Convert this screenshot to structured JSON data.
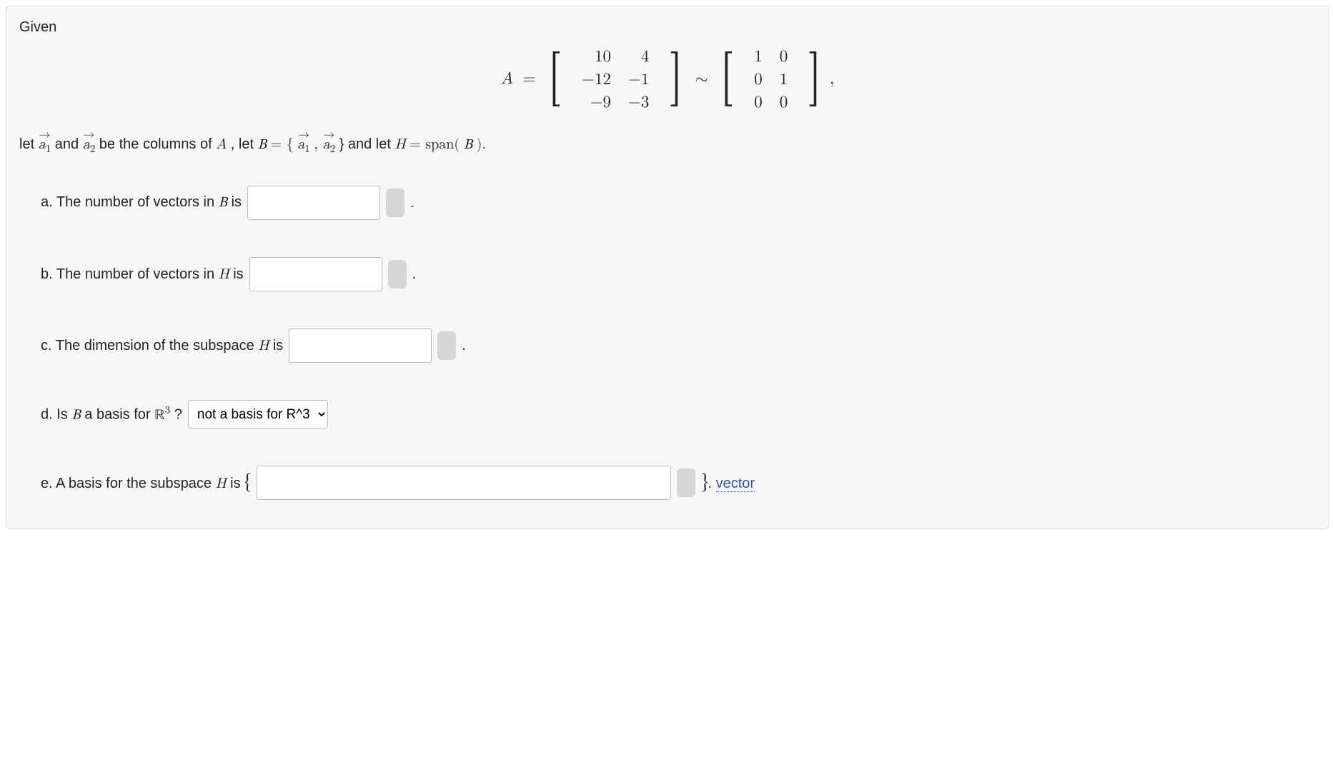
{
  "intro": "Given",
  "matrix_eq": {
    "lhs_var": "A",
    "eq": "=",
    "A": [
      [
        "10",
        "4"
      ],
      [
        "−12",
        "−1"
      ],
      [
        "−9",
        "−3"
      ]
    ],
    "tilde": "∼",
    "R": [
      [
        "1",
        "0"
      ],
      [
        "0",
        "1"
      ],
      [
        "0",
        "0"
      ]
    ],
    "trail": ","
  },
  "line2": {
    "pre": "let ",
    "a1": "a",
    "a1sub": "1",
    "and": " and ",
    "a2": "a",
    "a2sub": "2",
    "mid1": " be the columns of ",
    "Avar": "A",
    "mid2": ", let ",
    "Bvar": "B",
    "eqset1": " = {",
    "s_a1": "a",
    "s_a1sub": "1",
    "comma": ", ",
    "s_a2": "a",
    "s_a2sub": "2",
    "eqset2": "} and let ",
    "Hvar": "H",
    "eqspan": " = span(",
    "Bvar2": "B",
    "close": ")."
  },
  "qa": {
    "label": "a. The number of vectors in ",
    "Bvar": "B",
    "tail": " is",
    "value": "",
    "period": "."
  },
  "qb": {
    "label": "b. The number of vectors in ",
    "Hvar": "H",
    "tail": " is",
    "value": "",
    "period": "."
  },
  "qc": {
    "label": "c. The dimension of the subspace ",
    "Hvar": "H",
    "tail": " is",
    "value": "",
    "period": "."
  },
  "qd": {
    "label": "d. Is ",
    "Bvar": "B",
    "mid": " a basis for ",
    "R": "ℝ",
    "exp": "3",
    "qmark": "?",
    "selected": "not a basis for R^3"
  },
  "qe": {
    "label": "e. A basis for the subspace ",
    "Hvar": "H",
    "tail": " is ",
    "lbrace": "{",
    "value": "",
    "rbrace": "}",
    "period": ". ",
    "hint": "vector"
  }
}
